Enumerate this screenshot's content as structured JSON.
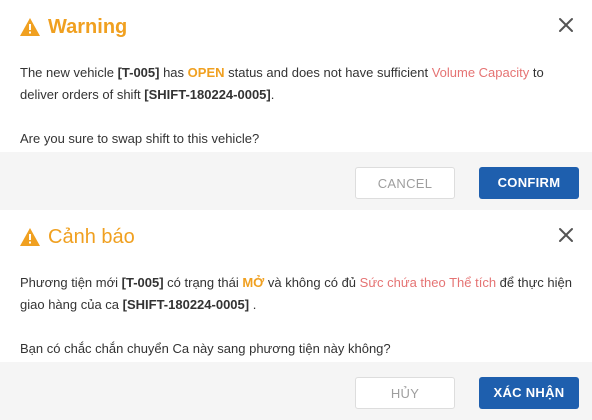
{
  "dialogs": [
    {
      "title": "Warning",
      "icon": "warning-icon",
      "body": {
        "p1_a": "The new vehicle ",
        "vehicle": "[T-005]",
        "p1_b": " has ",
        "status": "OPEN",
        "p1_c": " status and does not have sufficient ",
        "capacity": "Volume Capacity",
        "p1_d": " to deliver orders of shift ",
        "shift": "[SHIFT-180224-0005]",
        "p1_e": ".",
        "question": "Are you sure to swap shift to this vehicle?"
      },
      "cancel_label": "CANCEL",
      "confirm_label": "CONFIRM"
    },
    {
      "title": "Cảnh báo",
      "icon": "warning-icon",
      "body": {
        "p1_a": "Phương tiện mới ",
        "vehicle": "[T-005]",
        "p1_b": " có trạng thái ",
        "status": "MỞ",
        "p1_c": " và không có đủ ",
        "capacity": "Sức chứa theo Thể tích",
        "p1_d": " để thực hiện giao hàng của ca ",
        "shift": "[SHIFT-180224-0005]",
        "p1_e": " .",
        "question": "Bạn có chắc chắn chuyển Ca này sang phương tiện này không?"
      },
      "cancel_label": "HỦY",
      "confirm_label": "XÁC NHẬN"
    }
  ],
  "colors": {
    "title": "#f0a020",
    "status": "#f0a020",
    "highlight": "#e57373",
    "confirm_bg": "#1e5fae",
    "footer_bg": "#f5f5f5"
  }
}
